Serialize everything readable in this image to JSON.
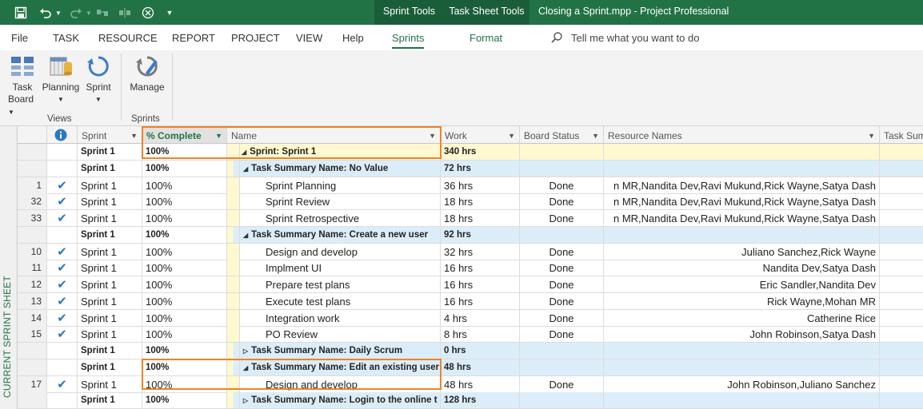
{
  "window": {
    "doc_title": "Closing a Sprint.mpp  -  Project Professional",
    "ctx_tabs": [
      "Sprint Tools",
      "Task Sheet Tools"
    ]
  },
  "menu": {
    "tabs": [
      "File",
      "TASK",
      "RESOURCE",
      "REPORT",
      "PROJECT",
      "VIEW",
      "Help",
      "Sprints",
      "Format"
    ],
    "selected": "Sprints",
    "tell_me": "Tell me what you want to do"
  },
  "ribbon": {
    "task_board_line1": "Task",
    "task_board_line2": "Board",
    "planning": "Planning",
    "sprint": "Sprint",
    "manage": "Manage",
    "group_views": "Views",
    "group_sprints": "Sprints"
  },
  "side_label": "CURRENT SPRINT SHEET",
  "columns": {
    "sprint": "Sprint",
    "complete": "% Complete",
    "name": "Name",
    "work": "Work",
    "board_status": "Board Status",
    "resource_names": "Resource Names",
    "task_summary": "Task Sum"
  },
  "rows": [
    {
      "id": "",
      "check": false,
      "sprint": "Sprint 1",
      "complete": "100%",
      "name": "Sprint: Sprint 1",
      "work": "340 hrs",
      "status": "",
      "resources": "",
      "kind": "top"
    },
    {
      "id": "",
      "check": false,
      "sprint": "Sprint 1",
      "complete": "100%",
      "name": "Task Summary Name: No Value",
      "work": "72 hrs",
      "status": "",
      "resources": "",
      "kind": "sum"
    },
    {
      "id": "1",
      "check": true,
      "sprint": "Sprint 1",
      "complete": "100%",
      "name": "Sprint Planning",
      "work": "36 hrs",
      "status": "Done",
      "resources": "n MR,Nandita Dev,Ravi Mukund,Rick Wayne,Satya Dash",
      "kind": "task"
    },
    {
      "id": "32",
      "check": true,
      "sprint": "Sprint 1",
      "complete": "100%",
      "name": "Sprint Review",
      "work": "18 hrs",
      "status": "Done",
      "resources": "n MR,Nandita Dev,Ravi Mukund,Rick Wayne,Satya Dash",
      "kind": "task"
    },
    {
      "id": "33",
      "check": true,
      "sprint": "Sprint 1",
      "complete": "100%",
      "name": "Sprint Retrospective",
      "work": "18 hrs",
      "status": "Done",
      "resources": "n MR,Nandita Dev,Ravi Mukund,Rick Wayne,Satya Dash",
      "kind": "task"
    },
    {
      "id": "",
      "check": false,
      "sprint": "Sprint 1",
      "complete": "100%",
      "name": "Task Summary Name: Create a new user",
      "work": "92 hrs",
      "status": "",
      "resources": "",
      "kind": "sum"
    },
    {
      "id": "10",
      "check": true,
      "sprint": "Sprint 1",
      "complete": "100%",
      "name": "Design and develop",
      "work": "32 hrs",
      "status": "Done",
      "resources": "Juliano Sanchez,Rick Wayne",
      "kind": "task"
    },
    {
      "id": "11",
      "check": true,
      "sprint": "Sprint 1",
      "complete": "100%",
      "name": "Implment UI",
      "work": "16 hrs",
      "status": "Done",
      "resources": "Nandita Dev,Satya Dash",
      "kind": "task"
    },
    {
      "id": "12",
      "check": true,
      "sprint": "Sprint 1",
      "complete": "100%",
      "name": "Prepare test plans",
      "work": "16 hrs",
      "status": "Done",
      "resources": "Eric Sandler,Nandita Dev",
      "kind": "task"
    },
    {
      "id": "13",
      "check": true,
      "sprint": "Sprint 1",
      "complete": "100%",
      "name": "Execute test plans",
      "work": "16 hrs",
      "status": "Done",
      "resources": "Rick Wayne,Mohan MR",
      "kind": "task"
    },
    {
      "id": "14",
      "check": true,
      "sprint": "Sprint 1",
      "complete": "100%",
      "name": "Integration work",
      "work": "4 hrs",
      "status": "Done",
      "resources": "Catherine Rice",
      "kind": "task"
    },
    {
      "id": "15",
      "check": true,
      "sprint": "Sprint 1",
      "complete": "100%",
      "name": "PO Review",
      "work": "8 hrs",
      "status": "Done",
      "resources": "John Robinson,Satya Dash",
      "kind": "task"
    },
    {
      "id": "",
      "check": false,
      "sprint": "Sprint 1",
      "complete": "100%",
      "name": "Task Summary Name: Daily Scrum",
      "work": "0 hrs",
      "status": "",
      "resources": "",
      "kind": "sumc"
    },
    {
      "id": "",
      "check": false,
      "sprint": "Sprint 1",
      "complete": "100%",
      "name": "Task Summary Name: Edit an existing user",
      "work": "48 hrs",
      "status": "",
      "resources": "",
      "kind": "sum"
    },
    {
      "id": "17",
      "check": true,
      "sprint": "Sprint 1",
      "complete": "100%",
      "name": "Design and develop",
      "work": "48 hrs",
      "status": "Done",
      "resources": "John Robinson,Juliano Sanchez",
      "kind": "task"
    },
    {
      "id": "",
      "check": false,
      "sprint": "Sprint 1",
      "complete": "100%",
      "name": "Task Summary Name: Login to the online t",
      "work": "128 hrs",
      "status": "",
      "resources": "",
      "kind": "sumc"
    }
  ]
}
